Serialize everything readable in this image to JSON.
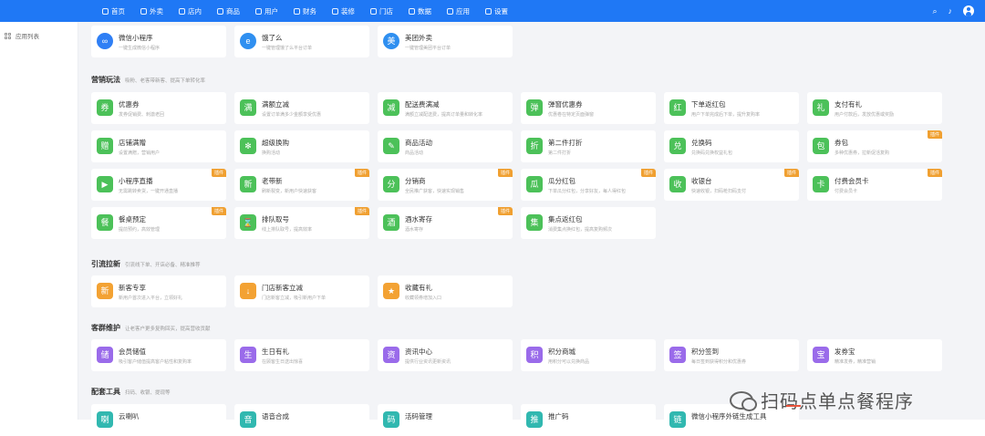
{
  "nav": {
    "items": [
      {
        "label": "首页",
        "icon": "home-icon"
      },
      {
        "label": "外卖",
        "icon": "takeout-icon"
      },
      {
        "label": "店内",
        "icon": "store-icon"
      },
      {
        "label": "商品",
        "icon": "goods-icon"
      },
      {
        "label": "用户",
        "icon": "user-icon"
      },
      {
        "label": "财务",
        "icon": "finance-icon"
      },
      {
        "label": "装修",
        "icon": "decoration-icon"
      },
      {
        "label": "门店",
        "icon": "shop-icon"
      },
      {
        "label": "数据",
        "icon": "chart-icon"
      },
      {
        "label": "应用",
        "icon": "apps-icon"
      },
      {
        "label": "设置",
        "icon": "settings-icon"
      }
    ],
    "right_icons": [
      "search-icon",
      "bell-icon",
      "avatar"
    ]
  },
  "sidebar": {
    "items": [
      {
        "label": "应用列表",
        "icon": "grid-icon"
      }
    ]
  },
  "sections": [
    {
      "title": "",
      "sub": "",
      "cards": [
        {
          "title": "微信小程序",
          "desc": "一键生成微信小程序",
          "color": "#2f7ff5",
          "glyph": "∞",
          "round": false,
          "badge": ""
        },
        {
          "title": "饿了么",
          "desc": "一键管理饿了么平台订单",
          "color": "#2f8ff0",
          "glyph": "e",
          "round": false,
          "badge": ""
        },
        {
          "title": "美团外卖",
          "desc": "一键管理美团平台订单",
          "color": "#2f8ff0",
          "glyph": "美",
          "round": false,
          "badge": ""
        }
      ]
    },
    {
      "title": "营销玩法",
      "sub": "吸粉、老客带新客、提高下单转化率",
      "cards": [
        {
          "title": "优惠券",
          "desc": "发券促销费、刺激老回",
          "color": "#4cc159",
          "glyph": "券",
          "badge": ""
        },
        {
          "title": "满额立减",
          "desc": "设置订单满多少金额享受优惠",
          "color": "#4cc159",
          "glyph": "满",
          "badge": ""
        },
        {
          "title": "配送费满减",
          "desc": "满额立减配送费，提高订单量和转化率",
          "color": "#4cc159",
          "glyph": "减",
          "badge": ""
        },
        {
          "title": "弹窗优惠券",
          "desc": "优惠卷在特定页面弹窗",
          "color": "#4cc159",
          "glyph": "弹",
          "badge": ""
        },
        {
          "title": "下单返红包",
          "desc": "用户下单完成后下单，提升复购率",
          "color": "#4cc159",
          "glyph": "红",
          "badge": ""
        },
        {
          "title": "支付有礼",
          "desc": "用户付款后，发放优惠或奖励",
          "color": "#4cc159",
          "glyph": "礼",
          "badge": ""
        },
        {
          "title": "店铺满赠",
          "desc": "设置满赠，营销用户",
          "color": "#4cc159",
          "glyph": "赠",
          "badge": ""
        },
        {
          "title": "超级换购",
          "desc": "换购活动",
          "color": "#4cc159",
          "glyph": "✻",
          "badge": ""
        },
        {
          "title": "商品活动",
          "desc": "商品活动",
          "color": "#4cc159",
          "glyph": "✎",
          "badge": ""
        },
        {
          "title": "第二件打折",
          "desc": "第二件打折",
          "color": "#4cc159",
          "glyph": "折",
          "badge": ""
        },
        {
          "title": "兑换码",
          "desc": "兑换码兑换权益礼包",
          "color": "#4cc159",
          "glyph": "兑",
          "badge": ""
        },
        {
          "title": "券包",
          "desc": "多种优惠券，拉新促活复购",
          "color": "#4cc159",
          "glyph": "包",
          "badge": "插件"
        },
        {
          "title": "小程序直播",
          "desc": "无需跳转卖货，一键开通直播",
          "color": "#4cc159",
          "glyph": "▶",
          "badge": "插件"
        },
        {
          "title": "老带新",
          "desc": "刷新裂变，新用户快速获客",
          "color": "#4cc159",
          "glyph": "新",
          "badge": "插件"
        },
        {
          "title": "分销商",
          "desc": "全民推广获客，快速实现销售",
          "color": "#4cc159",
          "glyph": "分",
          "badge": "插件"
        },
        {
          "title": "瓜分红包",
          "desc": "下单瓜分红包，分享好友，每人得红包",
          "color": "#4cc159",
          "glyph": "瓜",
          "badge": "插件"
        },
        {
          "title": "收银台",
          "desc": "快速收银，扫码枪扫码支付",
          "color": "#4cc159",
          "glyph": "收",
          "badge": "插件"
        },
        {
          "title": "付费会员卡",
          "desc": "付费会员卡",
          "color": "#4cc159",
          "glyph": "卡",
          "badge": "插件"
        },
        {
          "title": "餐桌预定",
          "desc": "提前预约，高效管理",
          "color": "#4cc159",
          "glyph": "餐",
          "badge": "插件"
        },
        {
          "title": "排队取号",
          "desc": "线上排队取号，提高效率",
          "color": "#4cc159",
          "glyph": "⌛",
          "badge": "插件"
        },
        {
          "title": "酒水寄存",
          "desc": "酒水寄存",
          "color": "#4cc159",
          "glyph": "酒",
          "badge": "插件"
        },
        {
          "title": "集点返红包",
          "desc": "消费集点换红包，提高复购频次",
          "color": "#4cc159",
          "glyph": "集",
          "badge": ""
        }
      ]
    },
    {
      "title": "引流拉新",
      "sub": "引流线下单、开店必备、精准推荐",
      "cards": [
        {
          "title": "新客专享",
          "desc": "新用户首次进入平台，立领好礼",
          "color": "#f3a233",
          "glyph": "新",
          "badge": ""
        },
        {
          "title": "门店新客立减",
          "desc": "门店新客立减，吸引新用户下单",
          "color": "#f3a233",
          "glyph": "↓",
          "badge": ""
        },
        {
          "title": "收藏有礼",
          "desc": "收藏领券增加入口",
          "color": "#f3a233",
          "glyph": "★",
          "badge": ""
        }
      ]
    },
    {
      "title": "客群维护",
      "sub": "让老客户更多复购回买，提高营收贡献",
      "cards": [
        {
          "title": "会员储值",
          "desc": "吸引客户储值提高客户粘性和复购率",
          "color": "#9a6bea",
          "glyph": "储",
          "badge": ""
        },
        {
          "title": "生日有礼",
          "desc": "在顾客生日送出惊喜",
          "color": "#9a6bea",
          "glyph": "生",
          "badge": ""
        },
        {
          "title": "资讯中心",
          "desc": "提供行业资讯更新资讯",
          "color": "#9a6bea",
          "glyph": "资",
          "badge": ""
        },
        {
          "title": "积分商城",
          "desc": "用积分可以兑换商品",
          "color": "#9a6bea",
          "glyph": "积",
          "badge": ""
        },
        {
          "title": "积分签到",
          "desc": "每日签到获得积分和优惠券",
          "color": "#9a6bea",
          "glyph": "签",
          "badge": ""
        },
        {
          "title": "发券宝",
          "desc": "精准发券，精准营销",
          "color": "#9a6bea",
          "glyph": "宝",
          "badge": ""
        }
      ]
    },
    {
      "title": "配套工具",
      "sub": "扫码、收银、提现等",
      "cards": [
        {
          "title": "云喇叭",
          "desc": "",
          "color": "#31b8b0",
          "glyph": "喇",
          "badge": ""
        },
        {
          "title": "语音合成",
          "desc": "",
          "color": "#31b8b0",
          "glyph": "音",
          "badge": ""
        },
        {
          "title": "活码管理",
          "desc": "",
          "color": "#31b8b0",
          "glyph": "码",
          "badge": ""
        },
        {
          "title": "推广码",
          "desc": "",
          "color": "#31b8b0",
          "glyph": "推",
          "badge": ""
        },
        {
          "title": "微信小程序外链生成工具",
          "desc": "",
          "color": "#31b8b0",
          "glyph": "链",
          "badge": ""
        }
      ]
    }
  ],
  "watermark": "扫码点单点餐程序"
}
